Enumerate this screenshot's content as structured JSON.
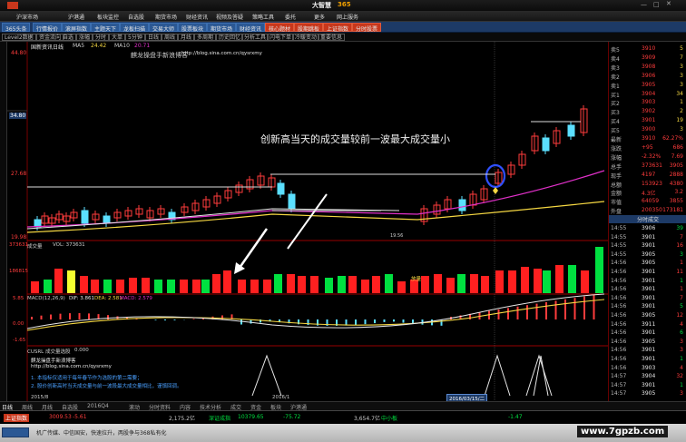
{
  "app": {
    "title": "大智慧",
    "title_suffix": "365",
    "colors": {
      "accent_red": "#ff3c3c",
      "accent_green": "#00e040",
      "cyan": "#5be0ff",
      "gold": "#f5d742",
      "magenta": "#e030c8"
    }
  },
  "menu": [
    "沪深市场",
    "沪港通",
    "板块监控",
    "自选股",
    "期货市场",
    "财经资讯",
    "视频及答疑",
    "策略工具",
    "委托",
    "更多",
    "网上服务"
  ],
  "toolbar": [
    "365头条",
    "行情报价",
    "滚屏指数",
    "主题天下",
    "龙板扫描",
    "交易大师",
    "股票板块",
    "期货市场",
    "财经资讯",
    "核心题材",
    "股期跳板",
    "上证指数",
    "分时股票"
  ],
  "subtool": [
    "Level2数据",
    "资金流向",
    "自选",
    "涨幅",
    "分时",
    "大单",
    "5分钟",
    "日线",
    "周线",
    "月线",
    "多周期",
    "历史回忆",
    "分析工具",
    "闪电下单",
    "冷暖变动",
    "重要信息"
  ],
  "chart_header": {
    "left": "国新资讯日线",
    "ma_label": "MA5",
    "ma_value": "24.42",
    "ma10_label": "MA10",
    "ma10_value": "20.71"
  },
  "price_axis": [
    "44.80",
    "34.80",
    "27.68",
    "19.98"
  ],
  "vol_panel": {
    "name": "成交量",
    "values": "VOL: 373631",
    "axis": [
      "373631",
      "186815"
    ]
  },
  "macd_panel": {
    "name": "MACD(12,26,9)",
    "dif": "DIF: 3.861",
    "dea": "DEA: 2.581",
    "macd": "MACD: 2.579",
    "axis": [
      "5.85",
      "0.00",
      "-1.65"
    ]
  },
  "cusr_panel": {
    "name": "CUSRL 成交量选股",
    "value": "0.000"
  },
  "annotation": "创新高当天的成交量较前一波最大成交量小",
  "watermark_texts": {
    "price": "麒龙操盘手新浪博客",
    "price_url": "http://blog.sina.com.cn/qysrxmy",
    "cusr": "麒龙操盘手新浪博客",
    "cusr_url": "http://blog.sina.com.cn/qysrxmy",
    "note1": "1. 本指标仅适用于每年春节作为选股的第二需要；",
    "note2": "2. 股价创新高时当天成交量与前一波段最大成交量相比，谨慎回调。"
  },
  "price_low_label": "19.56",
  "vol_marker": "放量",
  "date_box": "2016/03/15/二",
  "date_left": "2015/8",
  "date_mid": "2016/1",
  "quote": {
    "name": "国新",
    "rows": [
      {
        "l": "卖5",
        "m": "3910",
        "v": "5"
      },
      {
        "l": "卖4",
        "m": "3909",
        "v": "7"
      },
      {
        "l": "卖3",
        "m": "3908",
        "v": "3"
      },
      {
        "l": "卖2",
        "m": "3906",
        "v": "3"
      },
      {
        "l": "卖1",
        "m": "3905",
        "v": "3"
      },
      {
        "l": "买1",
        "m": "3904",
        "v": "34"
      },
      {
        "l": "买2",
        "m": "3903",
        "v": "1"
      },
      {
        "l": "买3",
        "m": "3902",
        "v": "2"
      },
      {
        "l": "买4",
        "m": "3901",
        "v": "19"
      },
      {
        "l": "买5",
        "m": "3900",
        "v": "3"
      }
    ],
    "stats": [
      {
        "l": "最新",
        "m": "3910",
        "v": "62.27%"
      },
      {
        "l": "涨跌",
        "m": "+95",
        "v": "686"
      },
      {
        "l": "涨幅",
        "m": "-2.32%",
        "v": "7.69"
      },
      {
        "l": "总手",
        "m": "373631",
        "v": "3905"
      },
      {
        "l": "现手",
        "m": "4197",
        "v": "2888"
      },
      {
        "l": "总额",
        "m": "153923",
        "v": "4380"
      },
      {
        "l": "金额",
        "m": "4.3亿",
        "v": "3.2"
      },
      {
        "l": "市值",
        "m": "64059",
        "v": "3855"
      },
      {
        "l": "外盘",
        "m": "200350",
        "v": "173181"
      }
    ],
    "trade_header": "分时成交",
    "trades": [
      {
        "t": "14:55",
        "p": "3906",
        "v": "39"
      },
      {
        "t": "14:55",
        "p": "3901",
        "v": "7"
      },
      {
        "t": "14:55",
        "p": "3901",
        "v": "16"
      },
      {
        "t": "14:55",
        "p": "3905",
        "v": "3"
      },
      {
        "t": "14:56",
        "p": "3905",
        "v": "1"
      },
      {
        "t": "14:56",
        "p": "3901",
        "v": "11"
      },
      {
        "t": "14:56",
        "p": "3901",
        "v": "1"
      },
      {
        "t": "14:56",
        "p": "3901",
        "v": "1"
      },
      {
        "t": "14:56",
        "p": "3901",
        "v": "7"
      },
      {
        "t": "14:56",
        "p": "3901",
        "v": "5"
      },
      {
        "t": "14:56",
        "p": "3905",
        "v": "12"
      },
      {
        "t": "14:56",
        "p": "3911",
        "v": "4"
      },
      {
        "t": "14:56",
        "p": "3901",
        "v": "6"
      },
      {
        "t": "14:56",
        "p": "3905",
        "v": "3"
      },
      {
        "t": "14:56",
        "p": "3901",
        "v": "3"
      },
      {
        "t": "14:56",
        "p": "3901",
        "v": "1"
      },
      {
        "t": "14:56",
        "p": "3903",
        "v": "4"
      },
      {
        "t": "14:57",
        "p": "3904",
        "v": "32"
      },
      {
        "t": "14:57",
        "p": "3901",
        "v": "1"
      },
      {
        "t": "14:57",
        "p": "3905",
        "v": "3"
      }
    ]
  },
  "bottom_tabs": [
    "日线",
    "周线",
    "月线",
    "自选股",
    "2016Q4",
    "滚动",
    "分时资料",
    "内容",
    "技术分析",
    "成交",
    "资金",
    "板块",
    "沪港通"
  ],
  "index_bar": [
    {
      "name": "上证指数",
      "v": "3009.53",
      "c": "-5.61",
      "color": "#ff3c3c"
    },
    {
      "name": "深证成指",
      "v": "10379.65",
      "c": "-75.72",
      "color": "#00e040"
    },
    {
      "name": "创业板指",
      "v": "2,175.2亿",
      "c": "",
      "color": "#ccc"
    },
    {
      "name": "中小板",
      "v": "3,654.7亿",
      "c": "-1.47",
      "color": "#00e040"
    }
  ],
  "status_text": "机广传媒、中信国安，快速拉升，两股争与368私有化",
  "site": "www.7gpzb.com"
}
